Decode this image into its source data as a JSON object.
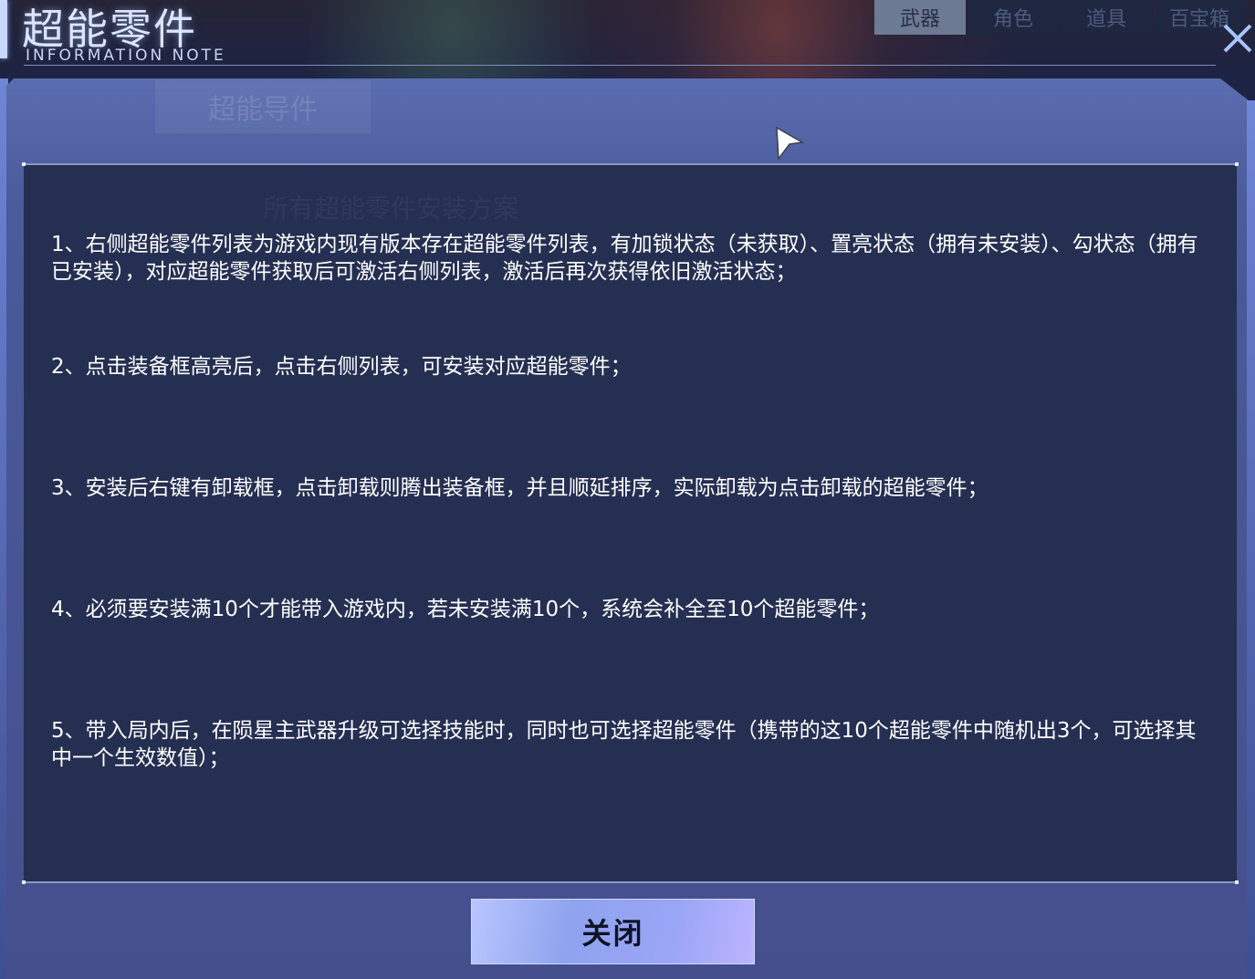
{
  "header": {
    "title": "超能零件",
    "subtitle": "INFORMATION NOTE"
  },
  "background_tabs": [
    "武器",
    "角色",
    "道具",
    "百宝箱"
  ],
  "ghost_tab_label": "超能导件",
  "ghost_heading": "所有超能零件安装方案",
  "notes": [
    "1、右侧超能零件列表为游戏内现有版本存在超能零件列表，有加锁状态（未获取）、置亮状态（拥有未安装）、勾状态（拥有已安装），对应超能零件获取后可激活右侧列表，激活后再次获得依旧激活状态；",
    "2、点击装备框高亮后，点击右侧列表，可安装对应超能零件；",
    "3、安装后右键有卸载框，点击卸载则腾出装备框，并且顺延排序，实际卸载为点击卸载的超能零件；",
    "4、必须要安装满10个才能带入游戏内，若未安装满10个，系统会补全至10个超能零件；",
    "5、带入局内后，在陨星主武器升级可选择技能时，同时也可选择超能零件（携带的这10个超能零件中随机出3个，可选择其中一个生效数值）；"
  ],
  "close_button_label": "关闭",
  "close_icon": "close-x-icon",
  "cursor_icon": "pointer-cursor-icon",
  "colors": {
    "panel": "#4a5a9a",
    "content_box": "#252f52",
    "title": "#dce6ff",
    "button": "#9aa5f6"
  }
}
